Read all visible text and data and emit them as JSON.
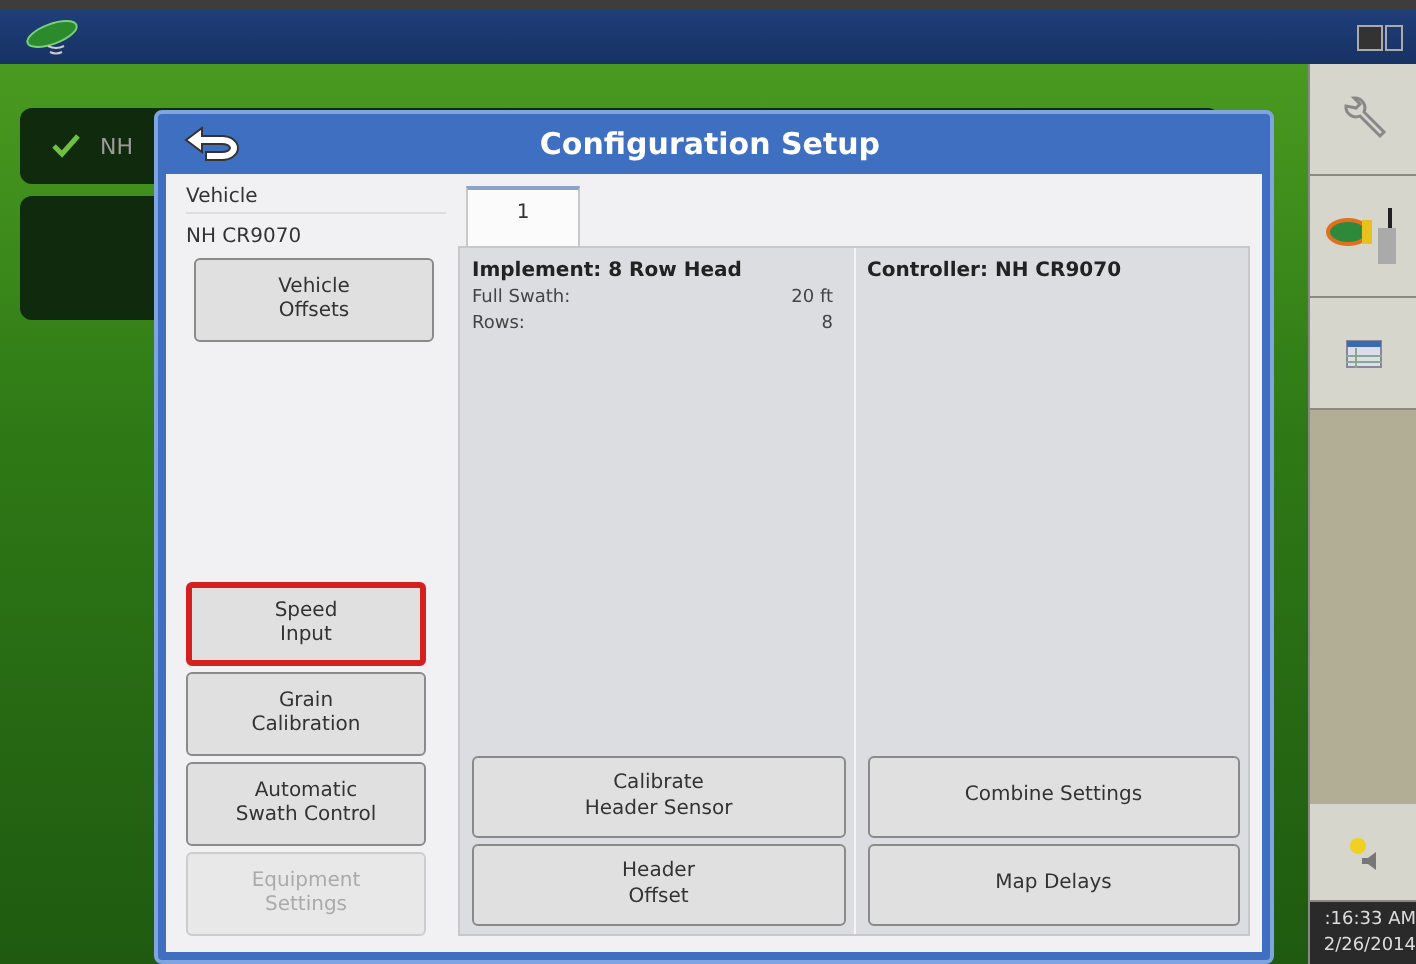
{
  "background": {
    "cards": [
      {
        "label": "NH",
        "checked": true
      },
      {
        "checked": false
      }
    ]
  },
  "dialog": {
    "title": "Configuration Setup",
    "vehicle": {
      "heading": "Vehicle",
      "name": "NH CR9070"
    },
    "top_buttons": [
      {
        "label": "Vehicle\nOffsets",
        "highlighted": false,
        "disabled": false
      }
    ],
    "bottom_buttons": [
      {
        "label": "Speed\nInput",
        "highlighted": true,
        "disabled": false
      },
      {
        "label": "Grain\nCalibration",
        "highlighted": false,
        "disabled": false
      },
      {
        "label": "Automatic\nSwath Control",
        "highlighted": false,
        "disabled": false
      },
      {
        "label": "Equipment\nSettings",
        "highlighted": false,
        "disabled": true
      }
    ],
    "tabs": [
      {
        "label": "1",
        "selected": true
      }
    ],
    "columns": [
      {
        "title": "Implement: 8 Row Head",
        "rows": [
          {
            "label": "Full Swath:",
            "value": "20 ft"
          },
          {
            "label": "Rows:",
            "value": "8"
          }
        ],
        "buttons": [
          "Calibrate\nHeader Sensor",
          "Header\nOffset"
        ]
      },
      {
        "title": "Controller: NH CR9070",
        "buttons": [
          "Combine Settings",
          "Map Delays"
        ]
      }
    ]
  },
  "status": {
    "time": ":16:33 AM",
    "date": "2/26/2014"
  }
}
